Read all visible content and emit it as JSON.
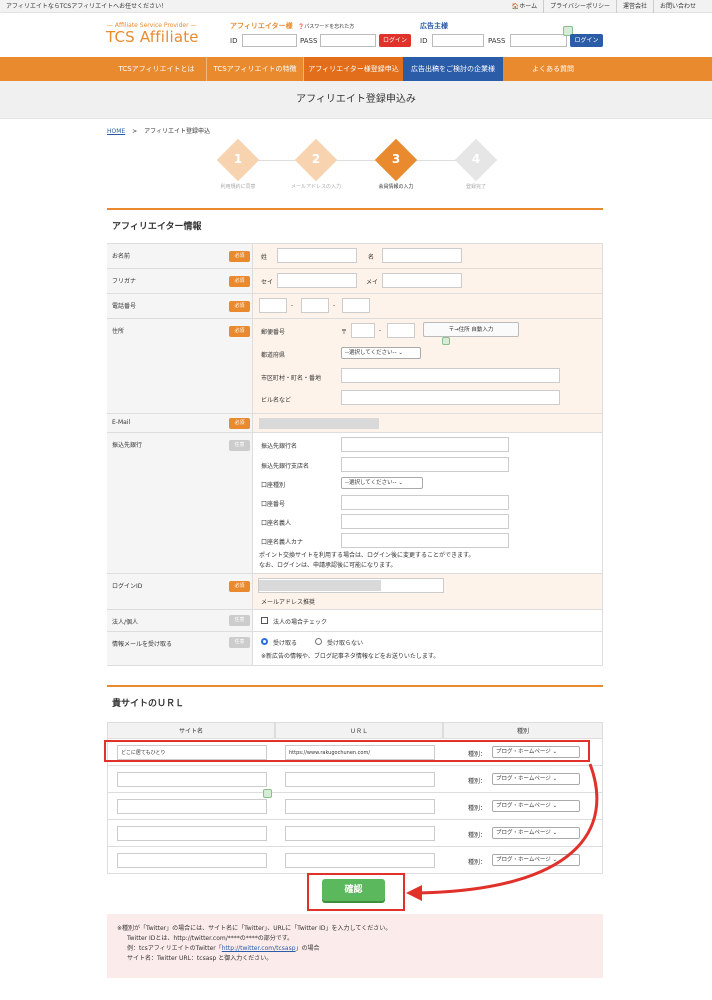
{
  "topbar": {
    "message": "アフィリエイトならTCSアフィリエイトへお任せください！",
    "links": [
      "🏠ホーム",
      "プライバシーポリシー",
      "運営会社",
      "お問い合わせ"
    ]
  },
  "header": {
    "logo_sub": "— Affiliate Service Provider —",
    "logo": "TCS Affiliate",
    "affiliate_title": "アフィリエイター様",
    "forgot": "パスワードを忘れた方",
    "advertiser_title": "広告主様",
    "id_label": "ID",
    "pass_label": "PASS",
    "login_label": "ログイン"
  },
  "nav": [
    "TCSアフィリエイトとは",
    "TCSアフィリエイトの特徴",
    "アフィリエイター様登録申込",
    "広告出稿をご検討の企業様",
    "よくある質問"
  ],
  "page_title": "アフィリエイト登録申込み",
  "breadcrumb": {
    "home": "HOME",
    "sep": ">",
    "current": "アフィリエイト登録申込"
  },
  "steps": [
    {
      "num": "1",
      "label": "利用規約に同意"
    },
    {
      "num": "2",
      "label": "メールアドレスの入力"
    },
    {
      "num": "3",
      "label": "会員情報の入力"
    },
    {
      "num": "4",
      "label": "登録完了"
    }
  ],
  "section1": "アフィリエイター情報",
  "badge_required": "必須",
  "badge_optional": "任意",
  "form": {
    "name": {
      "label": "お名前",
      "sei": "姓",
      "mei": "名"
    },
    "kana": {
      "label": "フリガナ",
      "sei": "セイ",
      "mei": "メイ"
    },
    "phone": {
      "label": "電話番号",
      "dash": "-"
    },
    "address": {
      "label": "住所",
      "zip": "郵便番号",
      "zip_mark": "〒",
      "zip_dash": "-",
      "auto": "〒→住所 自動入力",
      "pref": "都道府県",
      "pref_select": "--選択してください--",
      "city": "市区町村・町名・番地",
      "building": "ビル名など"
    },
    "email": {
      "label": "E-Mail"
    },
    "bank": {
      "label": "振込先銀行",
      "bank_name": "振込先銀行名",
      "branch": "振込先銀行支店名",
      "type": "口座種別",
      "type_select": "--選択してください--",
      "number": "口座番号",
      "holder": "口座名義人",
      "holder_kana": "口座名義人カナ",
      "note1": "ポイント交換サイトを利用する場合は、ログイン後に変更することができます。",
      "note2": "なお、ログインは、申請承認後に可能になります。"
    },
    "login_id": {
      "label": "ログインID",
      "hint": "メールアドレス推奨"
    },
    "corp": {
      "label": "法人/個人",
      "check": "法人の場合チェック"
    },
    "mail": {
      "label": "情報メールを受け取る",
      "yes": "受け取る",
      "no": "受け取らない",
      "note": "※新広告の情報や、ブログ記事ネタ情報などをお送りいたします。"
    }
  },
  "section2": "貴サイトのＵＲＬ",
  "url_table": {
    "headers": [
      "サイト名",
      "ＵＲＬ",
      "種別"
    ],
    "type_label": "種別：",
    "type_value": "ブログ・ホームページ",
    "rows": [
      {
        "site": "どこに居てもひとり",
        "url": "https://www.rakugochunen.com/"
      },
      {
        "site": "",
        "url": ""
      },
      {
        "site": "",
        "url": ""
      },
      {
        "site": "",
        "url": ""
      },
      {
        "site": "",
        "url": ""
      }
    ]
  },
  "confirm_button": "確認",
  "note": {
    "line1": "※種別が「Twitter」の場合には、サイト名に「Twitter」、URLに「Twitter ID」を入力してください。",
    "line2": "Twitter IDとは、http://twitter.com/****の****の部分です。",
    "line3a": "例：tcsアフィリエイトのTwitter「",
    "line3link": "http://twitter.com/tcsasp",
    "line3b": "」の場合",
    "line4": "サイト名：Twitter URL：tcsasp と御入力ください。"
  },
  "colors": {
    "brand": "#e98a2e",
    "blue": "#2a5ca8",
    "highlight": "#e0312a",
    "confirm": "#5cb85c"
  }
}
